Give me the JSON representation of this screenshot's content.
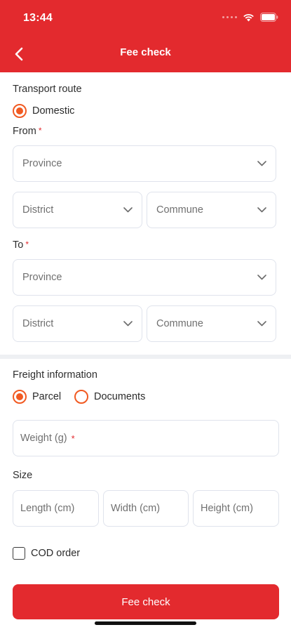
{
  "status_bar": {
    "time": "13:44",
    "icons": [
      "signal-dots-icon",
      "wifi-icon",
      "battery-icon"
    ]
  },
  "header": {
    "title": "Fee check",
    "back_icon": "chevron-left-icon",
    "background": "#e32a2e"
  },
  "transport": {
    "label": "Transport route",
    "option": "Domestic",
    "option_selected": true
  },
  "from": {
    "label": "From",
    "required_mark": "*",
    "province": "Province",
    "district": "District",
    "commune": "Commune"
  },
  "to": {
    "label": "To",
    "required_mark": "*",
    "province": "Province",
    "district": "District",
    "commune": "Commune"
  },
  "freight": {
    "label": "Freight information",
    "options": [
      {
        "label": "Parcel",
        "selected": true
      },
      {
        "label": "Documents",
        "selected": false
      }
    ],
    "weight_placeholder": "Weight (g)",
    "weight_required": "*"
  },
  "size": {
    "label": "Size",
    "length_placeholder": "Length (cm)",
    "width_placeholder": "Width (cm)",
    "height_placeholder": "Height (cm)"
  },
  "cod": {
    "label": "COD order",
    "checked": false
  },
  "submit": {
    "label": "Fee check"
  },
  "colors": {
    "brand_red": "#e32a2e",
    "radio_orange": "#f15a22",
    "border": "#dfe3ec"
  }
}
